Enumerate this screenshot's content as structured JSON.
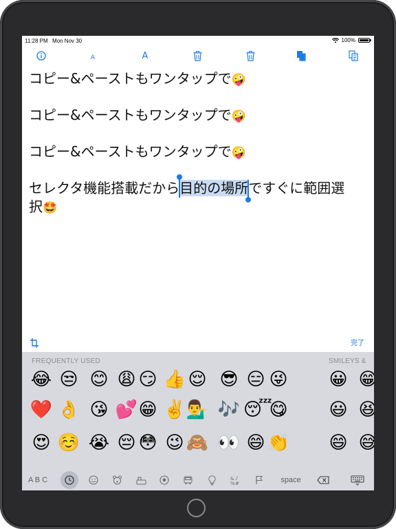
{
  "status": {
    "time": "11:28 PM",
    "date": "Mon Nov 30",
    "battery": "100%"
  },
  "toolbar": {
    "info": "info-icon",
    "font_small": "A",
    "font_large": "A",
    "trash1": "trash-icon",
    "trash2": "trash-icon",
    "copy": "copy-icon",
    "paste": "paste-icon"
  },
  "editor": {
    "lines": [
      {
        "text": "コピー&ペーストもワンタップで",
        "emoji": "🤪"
      },
      {
        "text": "コピー&ペーストもワンタップで",
        "emoji": "🤪"
      },
      {
        "text": "コピー&ペーストもワンタップで",
        "emoji": "🤪"
      }
    ],
    "select_line": {
      "before": "セレクタ機能搭載だから",
      "selected": "目的の場所",
      "after": "ですぐに範囲選",
      "wrap": "択",
      "emoji": "🤩"
    }
  },
  "accessory": {
    "done": "完了"
  },
  "keyboard": {
    "category_frequent": "FREQUENTLY USED",
    "category_smileys": "SMILEYS &",
    "rows": [
      [
        "😂",
        "😒",
        "😊",
        "😩",
        "😏",
        "👍",
        "😌",
        "😎",
        "😑",
        "😜",
        "😀",
        "😁"
      ],
      [
        "❤️",
        "👌",
        "😘",
        "💕",
        "😁",
        "✌️",
        "💁‍♂️",
        "🎶",
        "😴",
        "😋",
        "😃",
        "😆"
      ],
      [
        "😍",
        "☺️",
        "😭",
        "😔",
        "😳",
        "😉",
        "🙈",
        "👀",
        "😄",
        "👏",
        "😄",
        "😅"
      ]
    ],
    "bottom": {
      "abc": "A B C",
      "space": "space",
      "icons": [
        "clock-icon",
        "smiley-icon",
        "bear-icon",
        "food-icon",
        "ball-icon",
        "car-icon",
        "bulb-icon",
        "symbols-icon",
        "flag-icon",
        "delete-icon",
        "keyboard-dismiss-icon"
      ]
    }
  }
}
